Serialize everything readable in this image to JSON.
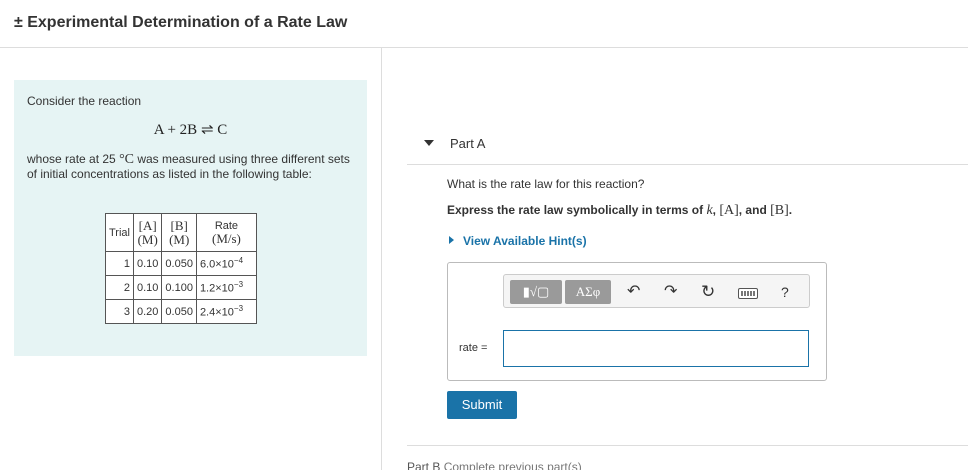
{
  "page": {
    "title": "± Experimental Determination of a Rate Law"
  },
  "problem": {
    "intro": "Consider the reaction",
    "reaction": "A + 2B ⇌ C",
    "desc_part1": "whose rate at 25 ",
    "desc_temp_unit": "°C",
    "desc_part2": " was measured using three different sets of initial concentrations as listed in the following table:",
    "table": {
      "headers": {
        "trial": "Trial",
        "a_top": "[A]",
        "a_unit": "(M)",
        "b_top": "[B]",
        "b_unit": "(M)",
        "rate_top": "Rate",
        "rate_unit": "(M/s)"
      },
      "rows": [
        {
          "trial": "1",
          "a": "0.10",
          "b": "0.050",
          "rate_base": "6.0×10",
          "rate_exp": "−4"
        },
        {
          "trial": "2",
          "a": "0.10",
          "b": "0.100",
          "rate_base": "1.2×10",
          "rate_exp": "−3"
        },
        {
          "trial": "3",
          "a": "0.20",
          "b": "0.050",
          "rate_base": "2.4×10",
          "rate_exp": "−3"
        }
      ]
    }
  },
  "partA": {
    "label": "Part A",
    "question": "What is the rate law for this reaction?",
    "instr_prefix": "Express the rate law symbolically in terms of ",
    "instr_k": "k",
    "instr_sep1": ", ",
    "instr_a": "[A]",
    "instr_sep2": ", and ",
    "instr_b": "[B]",
    "instr_end": ".",
    "hint": "View Available Hint(s)",
    "toolbar": {
      "matrix_label": "▮√▢",
      "greek_label": "ΑΣφ",
      "undo_icon": "undo-icon",
      "redo_icon": "redo-icon",
      "reset_icon": "reset-icon",
      "keyboard_icon": "keyboard-icon",
      "help_label": "?"
    },
    "answer_label": "rate =",
    "answer_value": "",
    "submit": "Submit"
  },
  "partB": {
    "label": "Part B",
    "status": "Complete previous part(s)"
  },
  "colors": {
    "accent": "#1a73a8",
    "panel_bg": "#e6f4f4",
    "toolbar_button": "#9a9a9a"
  }
}
